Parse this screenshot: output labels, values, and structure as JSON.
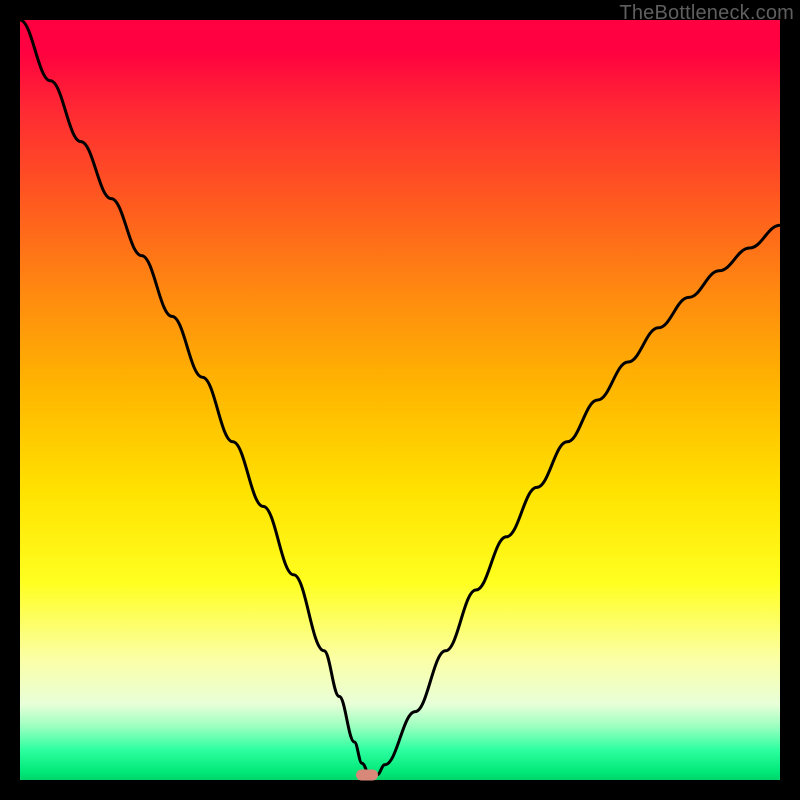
{
  "watermark": "TheBottleneck.com",
  "chart_data": {
    "type": "line",
    "title": "",
    "xlabel": "",
    "ylabel": "",
    "xlim": [
      0,
      100
    ],
    "ylim": [
      0,
      100
    ],
    "x": [
      0,
      4,
      8,
      12,
      16,
      20,
      24,
      28,
      32,
      36,
      40,
      42,
      44,
      45,
      46,
      47,
      48,
      52,
      56,
      60,
      64,
      68,
      72,
      76,
      80,
      84,
      88,
      92,
      96,
      100
    ],
    "values": [
      100,
      92,
      84,
      76.5,
      69,
      61,
      53,
      44.5,
      36,
      27,
      17,
      11,
      5,
      2.2,
      0.7,
      0.7,
      2,
      9,
      17,
      25,
      32,
      38.5,
      44.5,
      50,
      55,
      59.5,
      63.5,
      67,
      70,
      73
    ],
    "marker": {
      "x": 45.6,
      "y": 0.7
    },
    "gradient_stops": [
      {
        "pos": 0.0,
        "color": "#ff0040"
      },
      {
        "pos": 0.5,
        "color": "#ffe200"
      },
      {
        "pos": 0.85,
        "color": "#fbffa5"
      },
      {
        "pos": 1.0,
        "color": "#00d468"
      }
    ]
  }
}
